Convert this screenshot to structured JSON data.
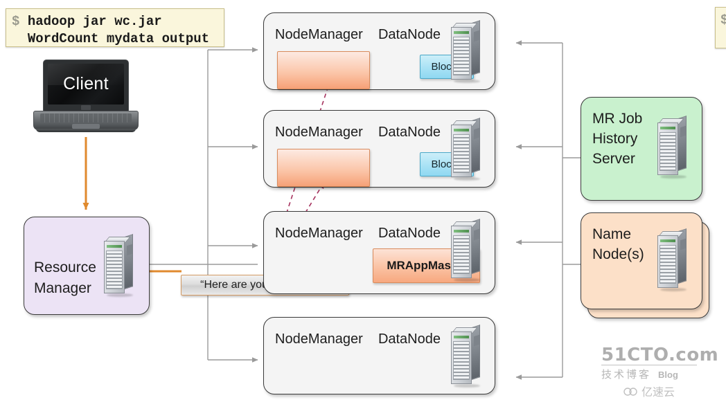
{
  "terminal_main": {
    "prompt": "$",
    "line1": "hadoop jar wc.jar",
    "line2": "WordCount mydata output"
  },
  "terminal_right": {
    "prompt": "$"
  },
  "client": {
    "label": "Client"
  },
  "resource_manager": {
    "label_line1": "Resource",
    "label_line2": "Manager",
    "color": "#ece3f5"
  },
  "callout": {
    "text": "“Here are your containers”"
  },
  "nodes": [
    {
      "nodemanager_label": "NodeManager",
      "datanode_label": "DataNode",
      "container": "",
      "block": "Block1",
      "has_container": true,
      "has_block": true,
      "has_mrappmaster": false
    },
    {
      "nodemanager_label": "NodeManager",
      "datanode_label": "DataNode",
      "container": "",
      "block": "Block2",
      "has_container": true,
      "has_block": true,
      "has_mrappmaster": false
    },
    {
      "nodemanager_label": "NodeManager",
      "datanode_label": "DataNode",
      "mrappmaster": "MRAppMaster",
      "has_container": false,
      "has_block": false,
      "has_mrappmaster": true
    },
    {
      "nodemanager_label": "NodeManager",
      "datanode_label": "DataNode",
      "has_container": false,
      "has_block": false,
      "has_mrappmaster": false
    }
  ],
  "services": [
    {
      "id": "history",
      "label_line1": "MR Job",
      "label_line2": "History",
      "label_line3": "Server",
      "color": "#c9f1ce"
    },
    {
      "id": "namenode",
      "label_line1": "Name",
      "label_line2": "Node(s)",
      "color": "#fce0c8"
    }
  ],
  "colors": {
    "container_fill": "#f6a177",
    "block_fill": "#8fd8f1",
    "orange_arrow": "#e08a2e",
    "dashed_arrow": "#a6325e",
    "gray_wire": "#9a9a9a",
    "terminal_bg": "#faf6dc"
  },
  "watermark": {
    "main": "51CTO.com",
    "sub": "技术博客",
    "blog": "Blog",
    "cloud": "亿速云"
  }
}
